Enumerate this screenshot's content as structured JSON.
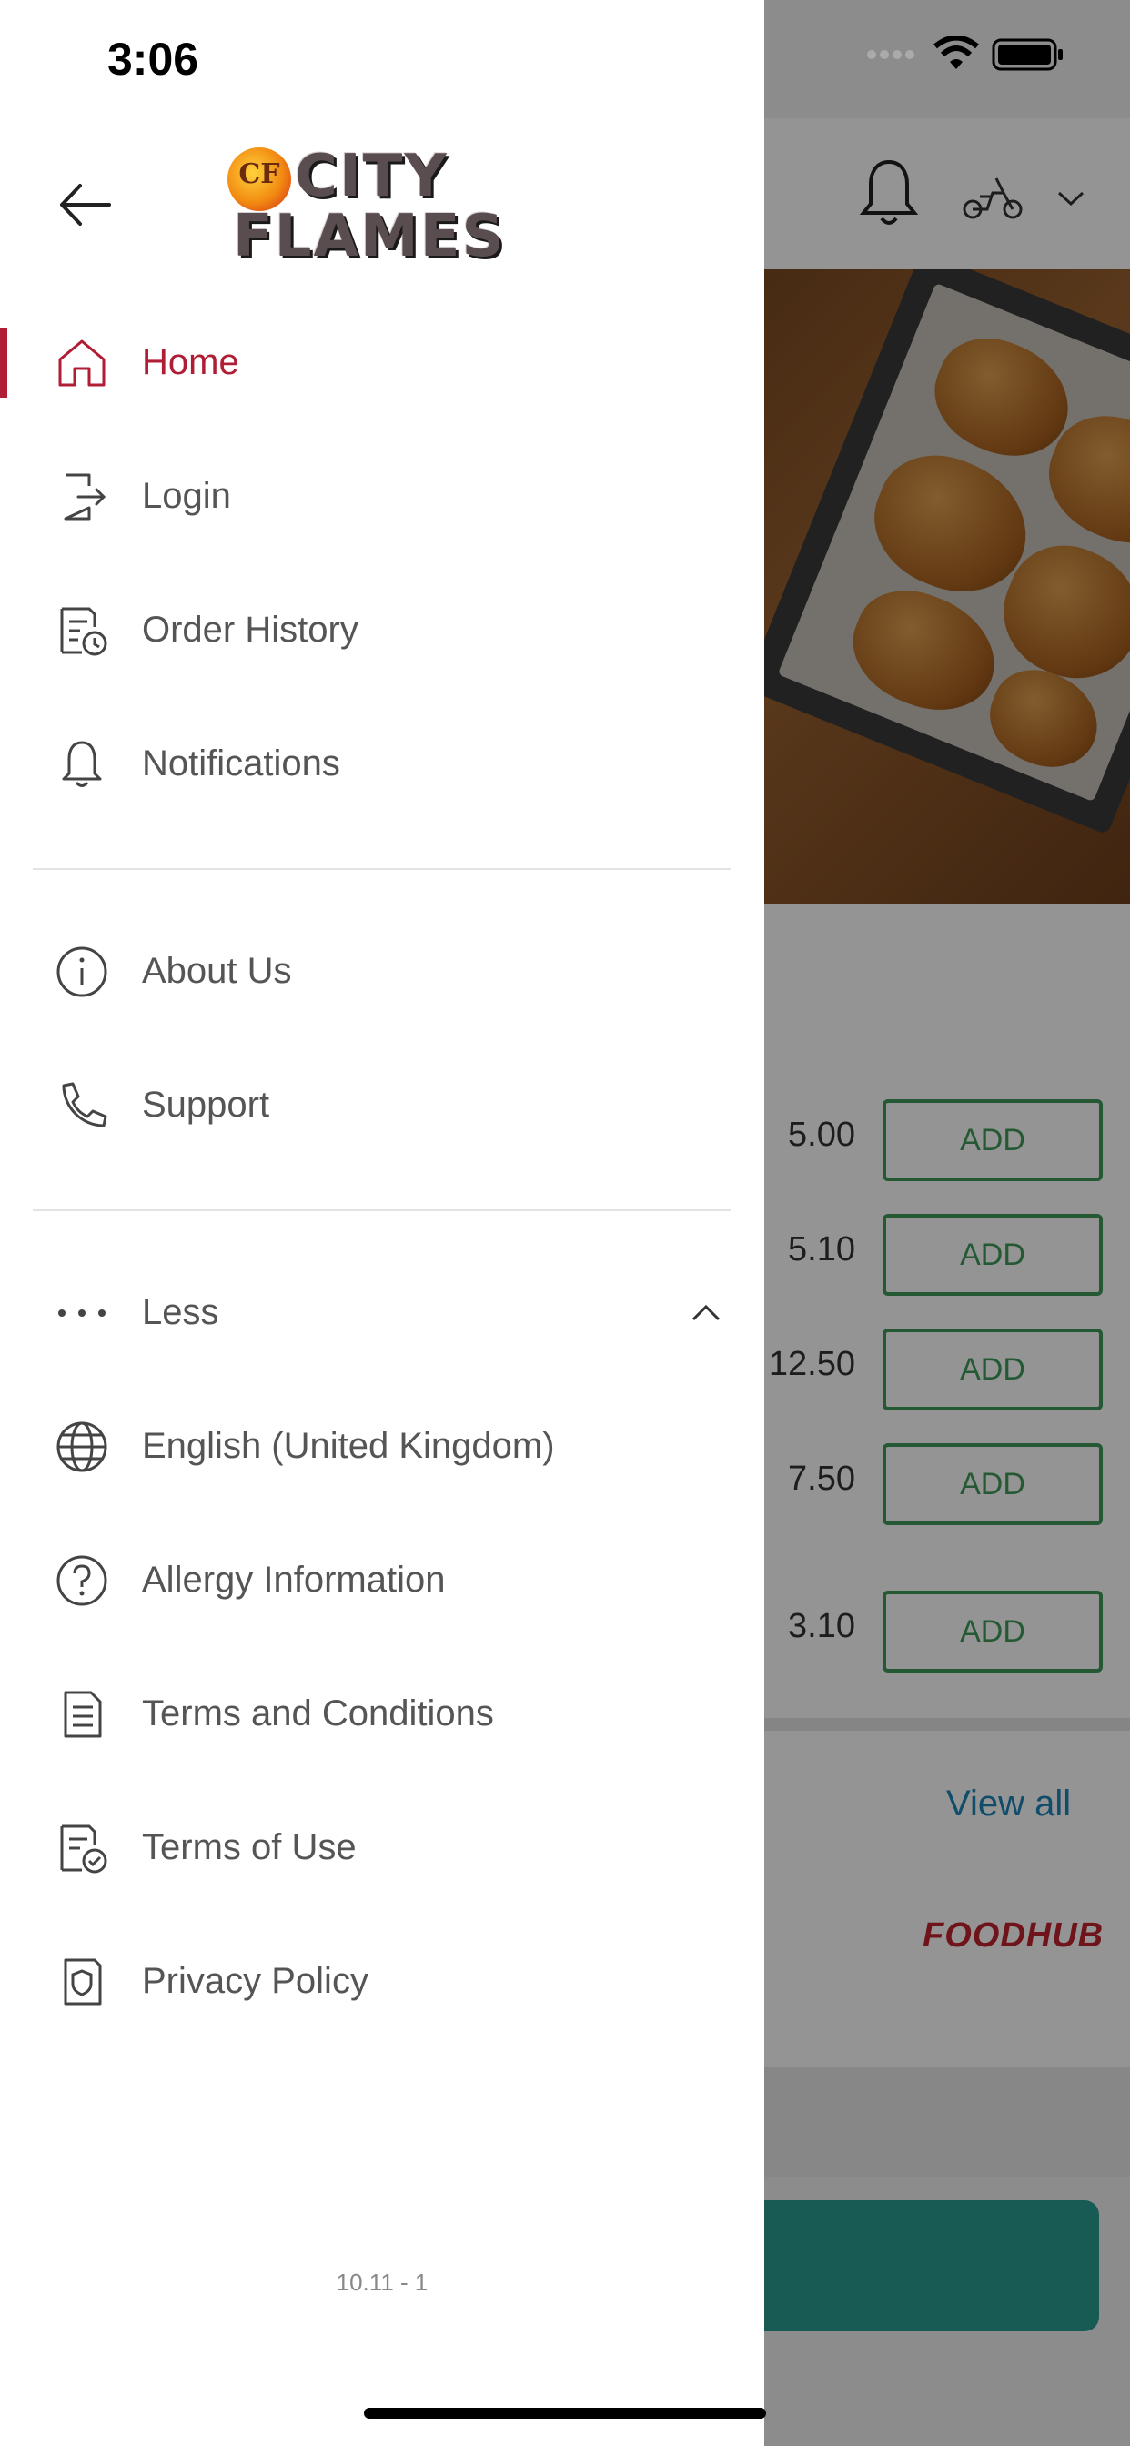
{
  "status_bar": {
    "time": "3:06"
  },
  "drawer": {
    "logo_text": {
      "line1": "CITY",
      "line2": "FLAMES",
      "badge": "CF"
    },
    "menu_primary": [
      {
        "label": "Home",
        "icon": "home-icon",
        "active": true
      },
      {
        "label": "Login",
        "icon": "login-icon"
      },
      {
        "label": "Order History",
        "icon": "order-history-icon"
      },
      {
        "label": "Notifications",
        "icon": "bell-icon"
      }
    ],
    "menu_secondary": [
      {
        "label": "About Us",
        "icon": "info-icon"
      },
      {
        "label": "Support",
        "icon": "phone-icon"
      }
    ],
    "less_toggle": {
      "label": "Less",
      "icon": "more-dots-icon",
      "expanded": true
    },
    "menu_more": [
      {
        "label": "English (United Kingdom)",
        "icon": "globe-icon"
      },
      {
        "label": "Allergy Information",
        "icon": "question-icon"
      },
      {
        "label": "Terms and Conditions",
        "icon": "document-icon"
      },
      {
        "label": "Terms of Use",
        "icon": "document-check-icon"
      },
      {
        "label": "Privacy Policy",
        "icon": "shield-icon"
      }
    ],
    "version": "10.11 - 1"
  },
  "background": {
    "prices": [
      "5.00",
      "5.10",
      "12.50",
      "7.50",
      "3.10"
    ],
    "add_label": "ADD",
    "view_all": "View all",
    "brand": "FOODHUB",
    "colors": {
      "accent": "#b01e35",
      "add_green": "#3f9a5b",
      "cta_teal": "#2a9d93"
    }
  }
}
